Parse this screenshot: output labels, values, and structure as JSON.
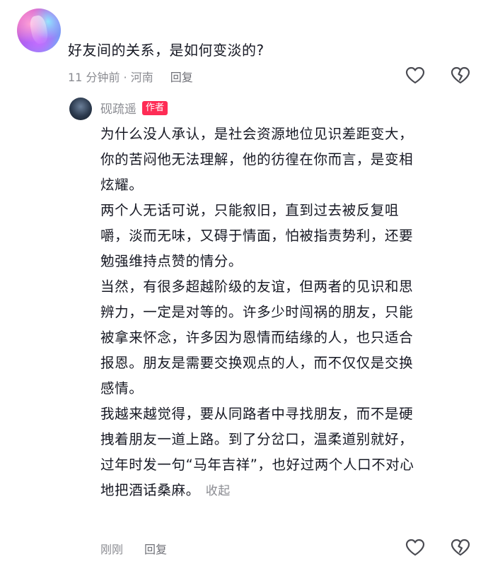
{
  "comment": {
    "text": "好友间的关系，是如何变淡的?",
    "time_location": "11 分钟前 · 河南",
    "reply_label": "回复",
    "like_icon": "heart-outline-icon",
    "dislike_icon": "broken-heart-icon"
  },
  "reply": {
    "username": "砚疏遥",
    "badge": "作者",
    "paragraphs": [
      "为什么没人承认，是社会资源地位见识差距变大，\n你的苦闷他无法理解，他的彷徨在你而言，是变相\n炫耀。",
      "两个人无话可说，只能叙旧，直到过去被反复咀\n嚼，淡而无味，又碍于情面，怕被指责势利，还要\n勉强维持点赞的情分。",
      "当然，有很多超越阶级的友谊，但两者的见识和思\n辨力，一定是对等的。许多少时闯祸的朋友，只能\n被拿来怀念，许多因为恩情而结缘的人，也只适合\n报恩。朋友是需要交换观点的人，而不仅仅是交换\n感情。",
      "我越来越觉得，要从同路者中寻找朋友，而不是硬\n拽着朋友一道上路。到了分岔口，温柔道别就好，\n过年时发一句“马年吉祥”，也好过两个人口不对心\n地把酒话桑麻。"
    ],
    "collapse_label": "收起",
    "time": "刚刚",
    "reply_label": "回复",
    "like_icon": "heart-outline-icon",
    "dislike_icon": "broken-heart-icon"
  },
  "colors": {
    "text": "#161823",
    "meta": "#8a8b91",
    "badge": "#fe2c55"
  }
}
